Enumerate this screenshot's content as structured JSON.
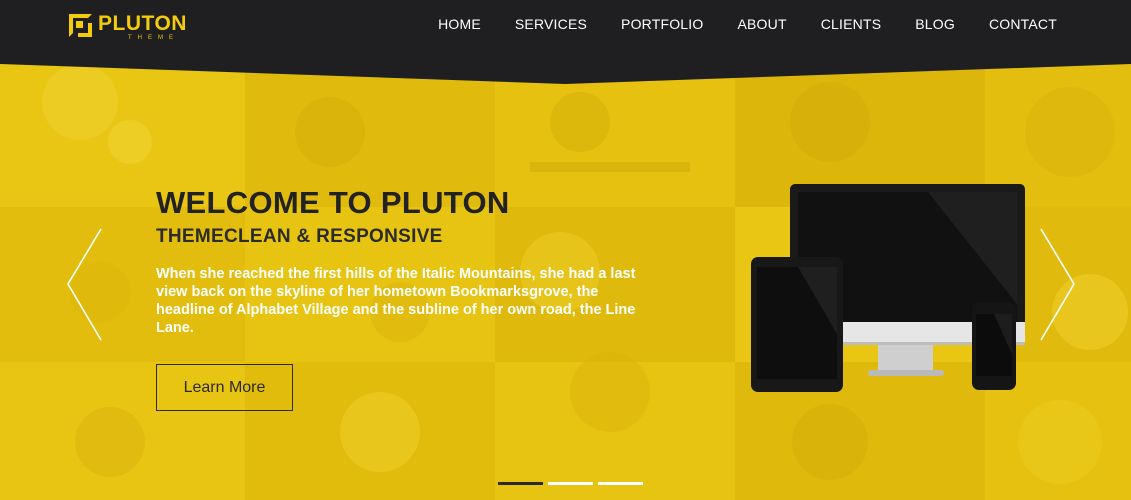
{
  "brand": {
    "title": "PLUTON",
    "subtitle": "THEME",
    "accent_color": "#f2cc0c",
    "header_bg": "#1f1f21"
  },
  "nav": {
    "items": [
      {
        "label": "HOME"
      },
      {
        "label": "SERVICES"
      },
      {
        "label": "PORTFOLIO"
      },
      {
        "label": "ABOUT"
      },
      {
        "label": "CLIENTS"
      },
      {
        "label": "BLOG"
      },
      {
        "label": "CONTACT"
      }
    ]
  },
  "hero": {
    "title": "WELCOME TO PLUTON",
    "subtitle": "THEMECLEAN & RESPONSIVE",
    "text": "When she reached the first hills of the Italic Mountains, she had a last view back on the skyline of her hometown Bookmarksgrove, the headline of Alphabet Village and the subline of her own road, the Line Lane.",
    "button_label": "Learn More",
    "bg_color": "#e6c20f",
    "prev_icon": "chevron-left-icon",
    "next_icon": "chevron-right-icon",
    "slides_count": 3,
    "active_slide": 1
  }
}
